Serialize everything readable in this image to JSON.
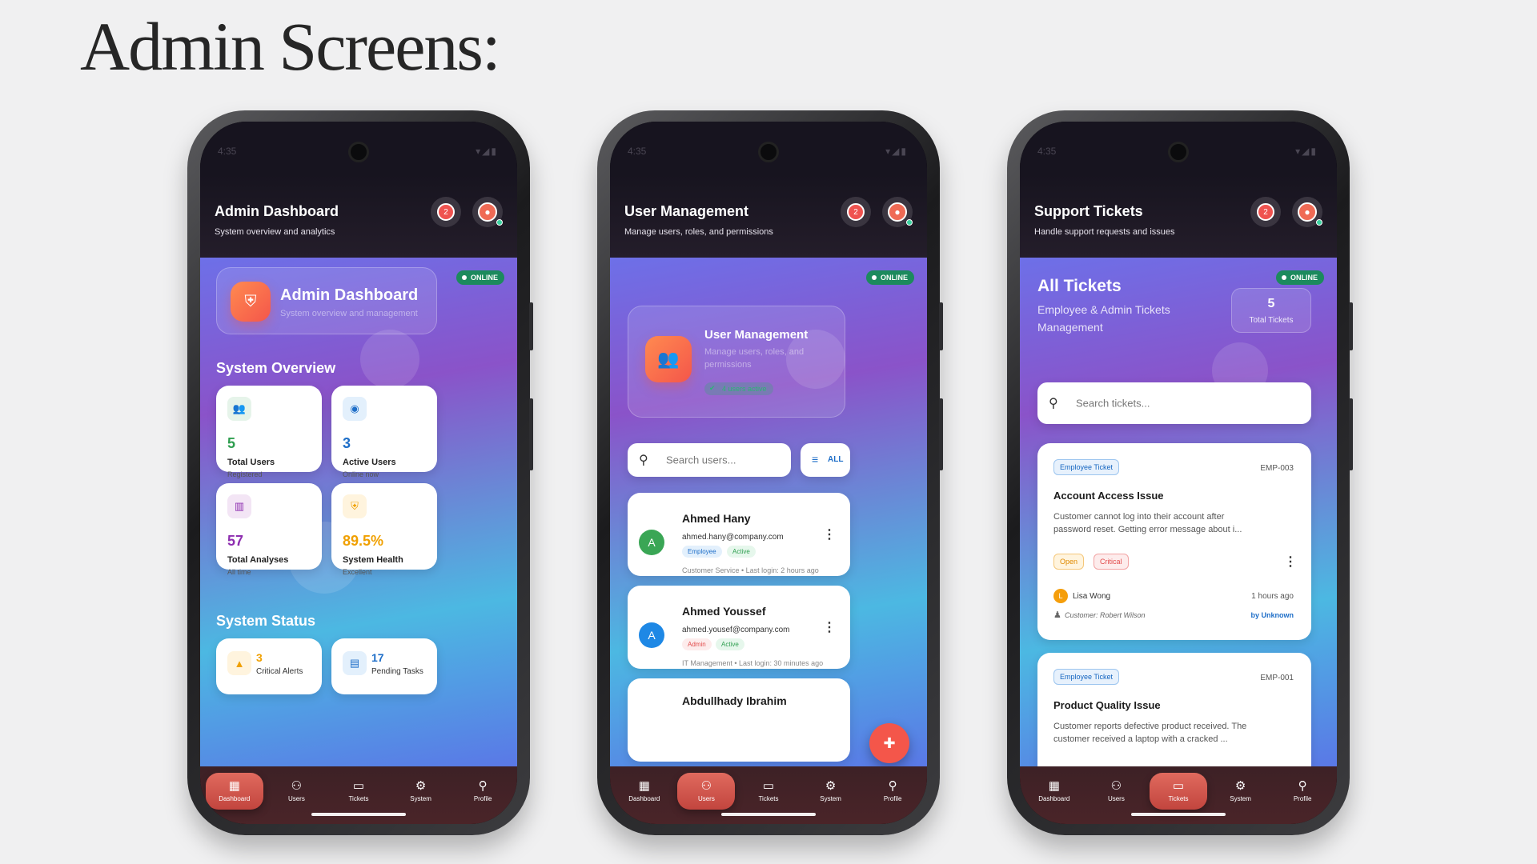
{
  "page_title": "Admin Screens:",
  "status": {
    "time": "4:35",
    "icons": "▾◢▮"
  },
  "shared": {
    "notif_count": "2"
  },
  "nav": {
    "dashboard": "Dashboard",
    "users": "Users",
    "tickets": "Tickets",
    "system": "System",
    "profile": "Profile"
  },
  "screen1": {
    "title": "Admin Dashboard",
    "subtitle": "System overview and analytics",
    "online": "ONLINE",
    "hero_title": "Admin Dashboard",
    "hero_sub": "System overview and management",
    "overview_label": "System Overview",
    "stats": [
      {
        "value": "5",
        "label": "Total Users",
        "sub": "Registered",
        "color": "#2e9e4f"
      },
      {
        "value": "3",
        "label": "Active Users",
        "sub": "Online now",
        "color": "#1e6ec8"
      },
      {
        "value": "57",
        "label": "Total Analyses",
        "sub": "All time",
        "color": "#8e2fb0"
      },
      {
        "value": "89.5%",
        "label": "System Health",
        "sub": "Excellent",
        "color": "#f0a000"
      }
    ],
    "status_label": "System Status",
    "status_cards": [
      {
        "value": "3",
        "label": "Critical Alerts",
        "color": "#f0a000"
      },
      {
        "value": "17",
        "label": "Pending Tasks",
        "color": "#1e6ec8"
      }
    ]
  },
  "screen2": {
    "title": "User Management",
    "subtitle": "Manage users, roles, and permissions",
    "online": "ONLINE",
    "hero_title": "User Management",
    "hero_sub": "Manage users, roles, and permissions",
    "hero_badge": "4 users active",
    "search_placeholder": "Search users...",
    "filter_label": "ALL",
    "users": [
      {
        "initial": "A",
        "name": "Ahmed Hany",
        "email": "ahmed.hany@company.com",
        "role": "Employee",
        "status": "Active",
        "meta": "Customer Service • Last login: 2 hours ago",
        "avatar_color": "#3aa655"
      },
      {
        "initial": "A",
        "name": "Ahmed Youssef",
        "email": "ahmed.yousef@company.com",
        "role": "Admin",
        "status": "Active",
        "meta": "IT Management • Last login: 30 minutes ago",
        "avatar_color": "#1e88e5"
      },
      {
        "name": "Abdullhady Ibrahim"
      }
    ]
  },
  "screen3": {
    "title": "Support Tickets",
    "subtitle": "Handle support requests and issues",
    "online": "ONLINE",
    "hero_title": "All Tickets",
    "hero_sub": "Employee & Admin Tickets Management",
    "total_value": "5",
    "total_label": "Total Tickets",
    "search_placeholder": "Search tickets...",
    "tickets": [
      {
        "type": "Employee Ticket",
        "id": "EMP-003",
        "title": "Account Access Issue",
        "desc": "Customer cannot log into their account after password reset. Getting error message about i...",
        "status": "Open",
        "priority": "Critical",
        "assignee_initial": "L",
        "assignee": "Lisa Wong",
        "ago": "1 hours ago",
        "customer": "Customer: Robert Wilson",
        "by": "by Unknown"
      },
      {
        "type": "Employee Ticket",
        "id": "EMP-001",
        "title": "Product Quality Issue",
        "desc": "Customer reports defective product received. The customer received a laptop with a cracked ..."
      }
    ]
  }
}
